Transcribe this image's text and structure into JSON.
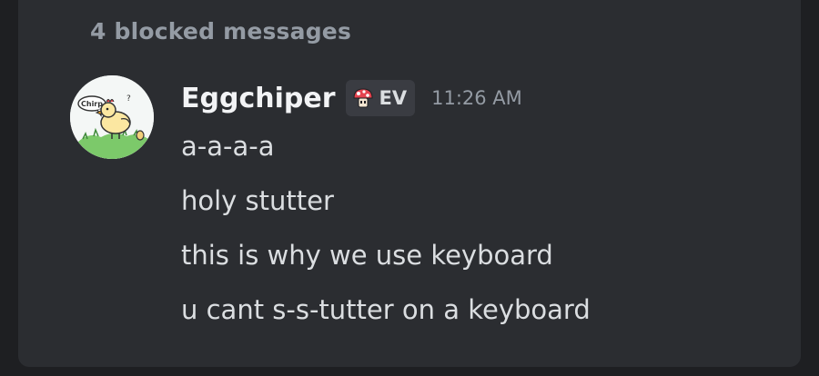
{
  "blocked_notice": "4 blocked messages",
  "message": {
    "author": "Eggchiper",
    "tag": {
      "icon": "mushroom-icon",
      "label": "EV"
    },
    "timestamp": "11:26 AM",
    "avatar": {
      "icon": "chicken-avatar-icon",
      "speech_text": "Chirp"
    },
    "lines": [
      "a-a-a-a",
      "holy stutter",
      "this is why we use keyboard",
      "u cant s-s-tutter on a keyboard"
    ]
  },
  "colors": {
    "background": "#1e1f22",
    "card": "#2b2d31",
    "username": "#f2f3f5",
    "text": "#dbdee1",
    "muted": "#949ba4",
    "tag_bg": "#3a3c42",
    "mushroom_red": "#e5434f"
  }
}
